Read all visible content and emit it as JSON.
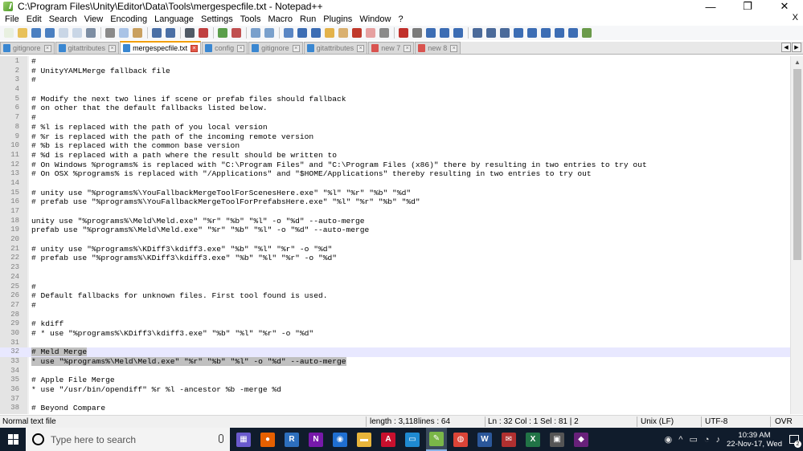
{
  "window": {
    "title": "C:\\Program Files\\Unity\\Editor\\Data\\Tools\\mergespecfile.txt - Notepad++",
    "controls": [
      "—",
      "❐",
      "✕"
    ]
  },
  "menu": {
    "items": [
      "File",
      "Edit",
      "Search",
      "View",
      "Encoding",
      "Language",
      "Settings",
      "Tools",
      "Macro",
      "Run",
      "Plugins",
      "Window",
      "?"
    ],
    "close_glyph": "X"
  },
  "toolbar": {
    "buttons": [
      {
        "icon": "new-file-icon",
        "color": "#e8f0e0"
      },
      {
        "icon": "open-file-icon",
        "color": "#e8c15a"
      },
      {
        "icon": "save-icon",
        "color": "#4a7fc1"
      },
      {
        "icon": "save-all-icon",
        "color": "#4a7fc1"
      },
      {
        "icon": "close-icon",
        "color": "#c9d6e6"
      },
      {
        "icon": "close-all-icon",
        "color": "#c9d6e6"
      },
      {
        "icon": "print-icon",
        "color": "#7c8da3"
      },
      {
        "sep": true
      },
      {
        "icon": "cut-icon",
        "color": "#8a8a8a"
      },
      {
        "icon": "copy-icon",
        "color": "#a9c3e6"
      },
      {
        "icon": "paste-icon",
        "color": "#c9a060"
      },
      {
        "sep": true
      },
      {
        "icon": "undo-icon",
        "color": "#4a6fa5"
      },
      {
        "icon": "redo-icon",
        "color": "#4a6fa5"
      },
      {
        "sep": true
      },
      {
        "icon": "find-icon",
        "color": "#505a66"
      },
      {
        "icon": "replace-icon",
        "color": "#c04040"
      },
      {
        "sep": true
      },
      {
        "icon": "zoom-in-icon",
        "color": "#5a9e4a"
      },
      {
        "icon": "zoom-out-icon",
        "color": "#c05050"
      },
      {
        "sep": true
      },
      {
        "icon": "sync-vertical-icon",
        "color": "#7aa0cc"
      },
      {
        "icon": "sync-horizontal-icon",
        "color": "#7aa0cc"
      },
      {
        "sep": true
      },
      {
        "icon": "word-wrap-icon",
        "color": "#5a86c4"
      },
      {
        "icon": "show-all-chars-icon",
        "color": "#3c6db4"
      },
      {
        "icon": "indent-guide-icon",
        "color": "#3c6db4"
      },
      {
        "icon": "udl-icon",
        "color": "#e3b24a"
      },
      {
        "icon": "doc-map-icon",
        "color": "#d9b070"
      },
      {
        "icon": "function-list-icon",
        "color": "#c0392b"
      },
      {
        "icon": "folder-workspace-icon",
        "color": "#e6a0a0"
      },
      {
        "icon": "monitoring-icon",
        "color": "#8a8a8a"
      },
      {
        "sep": true
      },
      {
        "icon": "record-macro-icon",
        "color": "#c0302b"
      },
      {
        "icon": "stop-record-icon",
        "color": "#7a7a7a"
      },
      {
        "icon": "playback-macro-icon",
        "color": "#3c6db4"
      },
      {
        "icon": "run-macro-multiple-icon",
        "color": "#3c6db4"
      },
      {
        "icon": "save-macro-icon",
        "color": "#3c6db4"
      },
      {
        "sep": true
      },
      {
        "icon": "compare-icon",
        "color": "#4a6a9a"
      },
      {
        "icon": "compare-prev-icon",
        "color": "#4a6a9a"
      },
      {
        "icon": "compare-next-icon",
        "color": "#4a6a9a"
      },
      {
        "icon": "compare-align-icon",
        "color": "#3c6db4"
      },
      {
        "icon": "arrow-up-icon",
        "color": "#3c6db4"
      },
      {
        "icon": "arrow-down-icon",
        "color": "#3c6db4"
      },
      {
        "icon": "compare-clear-icon",
        "color": "#3c6db4"
      },
      {
        "icon": "compare-panel-icon",
        "color": "#3c6db4"
      },
      {
        "icon": "compare-image-icon",
        "color": "#6a9a4a"
      }
    ]
  },
  "tabs": [
    {
      "label": "gitignore",
      "icon": "blue",
      "active": false
    },
    {
      "label": "gitattributes",
      "icon": "blue",
      "active": false
    },
    {
      "label": "mergespecfile.txt",
      "icon": "blue",
      "active": true
    },
    {
      "label": "config",
      "icon": "blue",
      "active": false
    },
    {
      "label": "gitignore",
      "icon": "blue",
      "active": false
    },
    {
      "label": "gitattributes",
      "icon": "blue",
      "active": false
    },
    {
      "label": "new 7",
      "icon": "red",
      "active": false
    },
    {
      "label": "new 8",
      "icon": "red",
      "active": false
    }
  ],
  "tab_nav": [
    "◀",
    "▶"
  ],
  "editor": {
    "current_line": 32,
    "selected_lines": [
      32,
      33
    ],
    "lines": [
      "#",
      "# UnityYAMLMerge fallback file",
      "#",
      "",
      "# Modify the next two lines if scene or prefab files should fallback",
      "# on other that the default fallbacks listed below.",
      "#",
      "# %l is replaced with the path of you local version",
      "# %r is replaced with the path of the incoming remote version",
      "# %b is replaced with the common base version",
      "# %d is replaced with a path where the result should be written to",
      "# On Windows %programs% is replaced with \"C:\\Program Files\" and \"C:\\Program Files (x86)\" there by resulting in two entries to try out",
      "# On OSX %programs% is replaced with \"/Applications\" and \"$HOME/Applications\" thereby resulting in two entries to try out",
      "",
      "# unity use \"%programs%\\YouFallbackMergeToolForScenesHere.exe\" \"%l\" \"%r\" \"%b\" \"%d\"",
      "# prefab use \"%programs%\\YouFallbackMergeToolForPrefabsHere.exe\" \"%l\" \"%r\" \"%b\" \"%d\"",
      "",
      "unity use \"%programs%\\Meld\\Meld.exe\" \"%r\" \"%b\" \"%l\" -o \"%d\" --auto-merge",
      "prefab use \"%programs%\\Meld\\Meld.exe\" \"%r\" \"%b\" \"%l\" -o \"%d\" --auto-merge",
      "",
      "# unity use \"%programs%\\KDiff3\\kdiff3.exe\" \"%b\" \"%l\" \"%r\" -o \"%d\"",
      "# prefab use \"%programs%\\KDiff3\\kdiff3.exe\" \"%b\" \"%l\" \"%r\" -o \"%d\"",
      "",
      "",
      "#",
      "# Default fallbacks for unknown files. First tool found is used.",
      "#",
      "",
      "# kdiff",
      "# * use \"%programs%\\KDiff3\\kdiff3.exe\" \"%b\" \"%l\" \"%r\" -o \"%d\"",
      "",
      "# Meld Merge",
      "* use \"%programs%\\Meld\\Meld.exe\" \"%r\" \"%b\" \"%l\" -o \"%d\" --auto-merge",
      "",
      "# Apple File Merge",
      "* use \"/usr/bin/opendiff\" %r %l -ancestor %b -merge %d",
      "",
      "# Beyond Compare"
    ]
  },
  "scrollbar": {
    "up": "▲",
    "down": "▼"
  },
  "status": {
    "file_type": "Normal text file",
    "length": "length : 3,118",
    "lines": "lines : 64",
    "position": "Ln : 32    Col : 1    Sel : 81 | 2",
    "eol": "Unix (LF)",
    "encoding": "UTF-8",
    "mode": "OVR"
  },
  "taskbar": {
    "search_placeholder": "Type here to search",
    "apps": [
      {
        "icon": "film-icon",
        "color": "#6a5acd",
        "glyph": "▦"
      },
      {
        "icon": "firefox-icon",
        "color": "#e66000",
        "glyph": "●"
      },
      {
        "icon": "r-icon",
        "color": "#2d6fbd",
        "glyph": "R"
      },
      {
        "icon": "onenote-icon",
        "color": "#7719aa",
        "glyph": "N"
      },
      {
        "icon": "maps-icon",
        "color": "#1f6fd1",
        "glyph": "◉"
      },
      {
        "icon": "folder-icon",
        "color": "#e8b53b",
        "glyph": "▬"
      },
      {
        "icon": "acrobat-icon",
        "color": "#c8102e",
        "glyph": "A"
      },
      {
        "icon": "remote-desktop-icon",
        "color": "#1f8ad1",
        "glyph": "▭"
      },
      {
        "icon": "notepadpp-icon",
        "color": "#7ab648",
        "glyph": "✎"
      },
      {
        "icon": "chrome-icon",
        "color": "#db4437",
        "glyph": "◍"
      },
      {
        "icon": "word-icon",
        "color": "#2b579a",
        "glyph": "W"
      },
      {
        "icon": "mail-icon",
        "color": "#b03030",
        "glyph": "✉"
      },
      {
        "icon": "excel-icon",
        "color": "#217346",
        "glyph": "X"
      },
      {
        "icon": "media-icon",
        "color": "#555555",
        "glyph": "▣"
      },
      {
        "icon": "visual-studio-icon",
        "color": "#68217a",
        "glyph": "◆"
      }
    ],
    "active_app_index": 8,
    "tray_icons": [
      "◉",
      "^",
      "▭",
      "◔",
      "♪"
    ],
    "time": "10:39 AM",
    "date": "22-Nov-17, Wed",
    "notification_count": "2"
  }
}
